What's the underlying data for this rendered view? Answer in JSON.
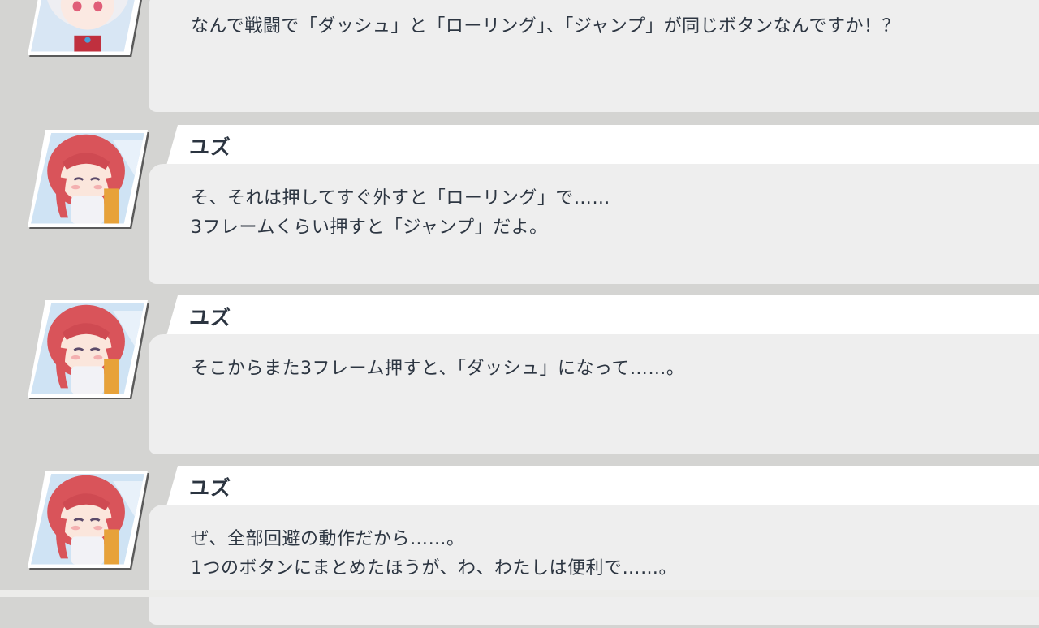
{
  "dialogue_log": [
    {
      "speaker": "",
      "avatar": "white-haired-student-portrait",
      "lines": [
        "なんで戦闘で「ダッシュ」と「ローリング」、「ジャンプ」が同じボタンなんですか！？"
      ]
    },
    {
      "speaker": "ユズ",
      "avatar": "yuzu-portrait",
      "lines": [
        "そ、それは押してすぐ外すと「ローリング」で……",
        "3フレームくらい押すと「ジャンプ」だよ。"
      ]
    },
    {
      "speaker": "ユズ",
      "avatar": "yuzu-portrait",
      "lines": [
        "そこからまた3フレーム押すと、「ダッシュ」になって……。"
      ]
    },
    {
      "speaker": "ユズ",
      "avatar": "yuzu-portrait",
      "lines": [
        "ぜ、全部回避の動作だから……。",
        "1つのボタンにまとめたほうが、わ、わたしは便利で……。"
      ]
    }
  ],
  "colors": {
    "background": "#d4d4d2",
    "name_bar": "#ffffff",
    "bubble": "#eeeeee",
    "text": "#2d3642",
    "yuzu_hair": "#d9545a",
    "white_hair": "#eeeef2"
  }
}
